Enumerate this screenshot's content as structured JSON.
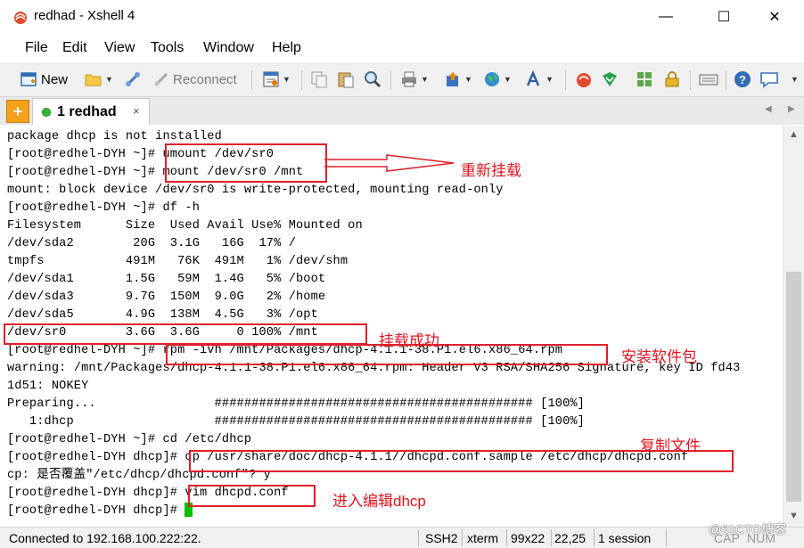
{
  "window": {
    "title": "redhad - Xshell 4",
    "controls": {
      "minimize": "—",
      "maximize": "☐",
      "close": "✕"
    }
  },
  "menu": [
    "File",
    "Edit",
    "View",
    "Tools",
    "Window",
    "Help"
  ],
  "toolbar": {
    "new_label": "New",
    "reconnect_label": "Reconnect"
  },
  "tabs": {
    "add_symbol": "+",
    "active_label": "1 redhad",
    "close_symbol": "×",
    "prev": "◀",
    "next": "▶"
  },
  "terminal": {
    "lines": [
      "package dhcp is not installed",
      "[root@redhel-DYH ~]# umount /dev/sr0",
      "[root@redhel-DYH ~]# mount /dev/sr0 /mnt",
      "mount: block device /dev/sr0 is write-protected, mounting read-only",
      "[root@redhel-DYH ~]# df -h",
      "Filesystem      Size  Used Avail Use% Mounted on",
      "/dev/sda2        20G  3.1G   16G  17% /",
      "tmpfs           491M   76K  491M   1% /dev/shm",
      "/dev/sda1       1.5G   59M  1.4G   5% /boot",
      "/dev/sda3       9.7G  150M  9.0G   2% /home",
      "/dev/sda5       4.9G  138M  4.5G   3% /opt",
      "/dev/sr0        3.6G  3.6G     0 100% /mnt",
      "[root@redhel-DYH ~]# rpm -ivh /mnt/Packages/dhcp-4.1.1-38.P1.el6.x86_64.rpm",
      "warning: /mnt/Packages/dhcp-4.1.1-38.P1.el6.x86_64.rpm: Header V3 RSA/SHA256 Signature, key ID fd43",
      "1d51: NOKEY",
      "Preparing...                ########################################### [100%]",
      "   1:dhcp                   ########################################### [100%]",
      "[root@redhel-DYH ~]# cd /etc/dhcp",
      "[root@redhel-DYH dhcp]# cp /usr/share/doc/dhcp-4.1.1//dhcpd.conf.sample /etc/dhcp/dhcpd.conf",
      "cp: 是否覆盖\"/etc/dhcp/dhcpd.conf\"? y",
      "[root@redhel-DYH dhcp]# vim dhcpd.conf",
      "[root@redhel-DYH dhcp]# "
    ],
    "cursor_color": "#00c000"
  },
  "annotations": {
    "remount": "重新挂载",
    "mount_success": "挂载成功",
    "install_package": "安装软件包",
    "copy_file": "复制文件",
    "edit_dhcp": "进入编辑dhcp",
    "color": "#e3151f"
  },
  "statusbar": {
    "connection": "Connected to 192.168.100.222:22.",
    "protocol": "SSH2",
    "terminal_type": "xterm",
    "size": "99x22",
    "cursor_pos": "22,25",
    "sessions": "1 session",
    "caps": "CAP",
    "num": "NUM"
  },
  "watermark": "@51CTO博客"
}
